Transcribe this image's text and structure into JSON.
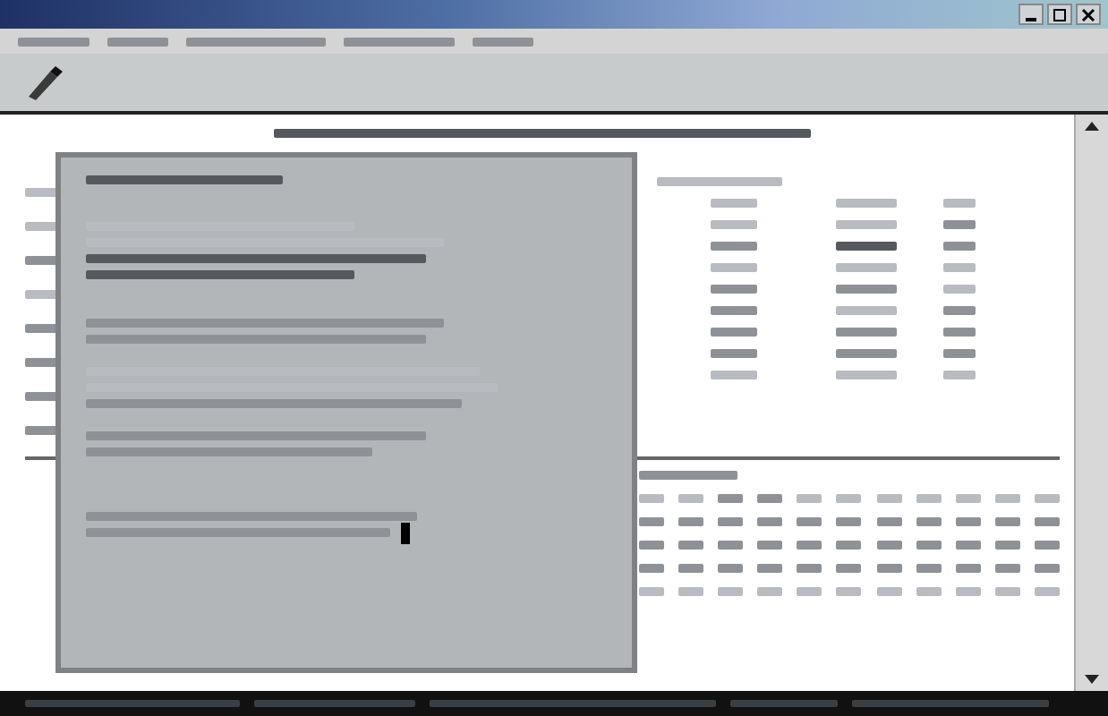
{
  "window": {
    "controls": [
      {
        "kind": "minimize"
      },
      {
        "kind": "maximize"
      },
      {
        "kind": "close"
      }
    ]
  },
  "menu_bar": {
    "items": [
      {
        "kind": "normal"
      },
      {
        "kind": "normal"
      },
      {
        "kind": "normal"
      },
      {
        "kind": "normal"
      },
      {
        "kind": "normal"
      }
    ]
  },
  "toolbar": {
    "items": [
      {
        "kind": "pen"
      }
    ]
  },
  "document": {
    "heading": {
      "kind": "strong"
    },
    "sidebar_lines": [
      {
        "kind": "faint"
      },
      {
        "kind": "faint"
      },
      {
        "kind": "normal"
      },
      {
        "kind": "faint"
      },
      {
        "kind": "normal"
      },
      {
        "kind": "normal"
      },
      {
        "kind": "normal"
      },
      {
        "kind": "normal"
      }
    ],
    "summary_caption": {
      "kind": "faint"
    },
    "summary_rows": [
      {
        "cells": [
          {
            "kind": "faint"
          },
          {
            "kind": "faint"
          },
          {
            "kind": "faint"
          }
        ]
      },
      {
        "cells": [
          {
            "kind": "faint"
          },
          {
            "kind": "faint"
          },
          {
            "kind": "normal"
          }
        ]
      },
      {
        "cells": [
          {
            "kind": "normal"
          },
          {
            "kind": "strong"
          },
          {
            "kind": "normal"
          }
        ]
      },
      {
        "cells": [
          {
            "kind": "faint"
          },
          {
            "kind": "faint"
          },
          {
            "kind": "faint"
          }
        ]
      },
      {
        "cells": [
          {
            "kind": "normal"
          },
          {
            "kind": "normal"
          },
          {
            "kind": "faint"
          }
        ]
      },
      {
        "cells": [
          {
            "kind": "normal"
          },
          {
            "kind": "faint"
          },
          {
            "kind": "normal"
          }
        ]
      },
      {
        "cells": [
          {
            "kind": "normal"
          },
          {
            "kind": "normal"
          },
          {
            "kind": "normal"
          }
        ]
      },
      {
        "cells": [
          {
            "kind": "normal"
          },
          {
            "kind": "normal"
          },
          {
            "kind": "normal"
          }
        ]
      },
      {
        "cells": [
          {
            "kind": "faint"
          },
          {
            "kind": "faint"
          },
          {
            "kind": "faint"
          }
        ]
      }
    ],
    "grid_caption": {
      "kind": "normal"
    },
    "grid_rows": [
      {
        "cells": [
          {
            "kind": "faint"
          },
          {
            "kind": "faint"
          },
          {
            "kind": "normal"
          },
          {
            "kind": "normal"
          },
          {
            "kind": "faint"
          },
          {
            "kind": "faint"
          },
          {
            "kind": "faint"
          },
          {
            "kind": "faint"
          },
          {
            "kind": "faint"
          },
          {
            "kind": "faint"
          },
          {
            "kind": "faint"
          }
        ]
      },
      {
        "cells": [
          {
            "kind": "normal"
          },
          {
            "kind": "normal"
          },
          {
            "kind": "normal"
          },
          {
            "kind": "normal"
          },
          {
            "kind": "normal"
          },
          {
            "kind": "normal"
          },
          {
            "kind": "normal"
          },
          {
            "kind": "normal"
          },
          {
            "kind": "normal"
          },
          {
            "kind": "normal"
          },
          {
            "kind": "normal"
          }
        ]
      },
      {
        "cells": [
          {
            "kind": "normal"
          },
          {
            "kind": "normal"
          },
          {
            "kind": "normal"
          },
          {
            "kind": "normal"
          },
          {
            "kind": "normal"
          },
          {
            "kind": "normal"
          },
          {
            "kind": "normal"
          },
          {
            "kind": "normal"
          },
          {
            "kind": "normal"
          },
          {
            "kind": "normal"
          },
          {
            "kind": "normal"
          }
        ]
      },
      {
        "cells": [
          {
            "kind": "normal"
          },
          {
            "kind": "normal"
          },
          {
            "kind": "normal"
          },
          {
            "kind": "normal"
          },
          {
            "kind": "normal"
          },
          {
            "kind": "normal"
          },
          {
            "kind": "normal"
          },
          {
            "kind": "normal"
          },
          {
            "kind": "normal"
          },
          {
            "kind": "normal"
          },
          {
            "kind": "normal"
          }
        ]
      },
      {
        "cells": [
          {
            "kind": "faint"
          },
          {
            "kind": "faint"
          },
          {
            "kind": "faint"
          },
          {
            "kind": "faint"
          },
          {
            "kind": "faint"
          },
          {
            "kind": "faint"
          },
          {
            "kind": "faint"
          },
          {
            "kind": "faint"
          },
          {
            "kind": "faint"
          },
          {
            "kind": "faint"
          },
          {
            "kind": "faint"
          }
        ]
      }
    ]
  },
  "popup": {
    "title": {
      "kind": "strong"
    },
    "lines": [
      {
        "kind": "gap"
      },
      {
        "kind": "faint"
      },
      {
        "kind": "faint"
      },
      {
        "kind": "strong"
      },
      {
        "kind": "strong"
      },
      {
        "kind": "gap"
      },
      {
        "kind": "gap"
      },
      {
        "kind": "normal"
      },
      {
        "kind": "normal"
      },
      {
        "kind": "gap"
      },
      {
        "kind": "faint"
      },
      {
        "kind": "faint"
      },
      {
        "kind": "normal"
      },
      {
        "kind": "gap"
      },
      {
        "kind": "normal"
      },
      {
        "kind": "normal"
      },
      {
        "kind": "gap"
      },
      {
        "kind": "gap"
      },
      {
        "kind": "gap"
      },
      {
        "kind": "normal"
      },
      {
        "kind": "normal"
      }
    ]
  }
}
